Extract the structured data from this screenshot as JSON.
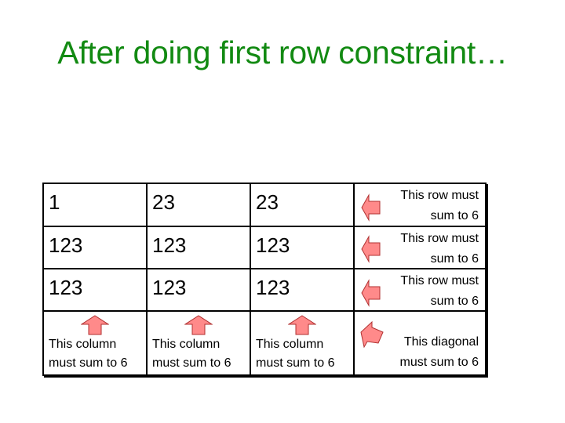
{
  "title": "After doing first row constraint…",
  "grid": {
    "rows": [
      [
        "1",
        "23",
        "23"
      ],
      [
        "123",
        "123",
        "123"
      ],
      [
        "123",
        "123",
        "123"
      ]
    ],
    "row_labels": [
      {
        "line1": "This row must",
        "line2": "sum to 6"
      },
      {
        "line1": "This row must",
        "line2": "sum to 6"
      },
      {
        "line1": "This row must",
        "line2": "sum to 6"
      }
    ],
    "column_labels": [
      {
        "line1": "This column",
        "line2": "must sum to 6"
      },
      {
        "line1": "This column",
        "line2": "must sum to 6"
      },
      {
        "line1": "This column",
        "line2": "must sum to 6"
      }
    ],
    "diagonal_label": {
      "line1": "This diagonal",
      "line2": "must sum to 6"
    }
  },
  "colors": {
    "title": "#128a12",
    "arrow_fill": "#ff8a8a",
    "arrow_stroke": "#b03030"
  }
}
